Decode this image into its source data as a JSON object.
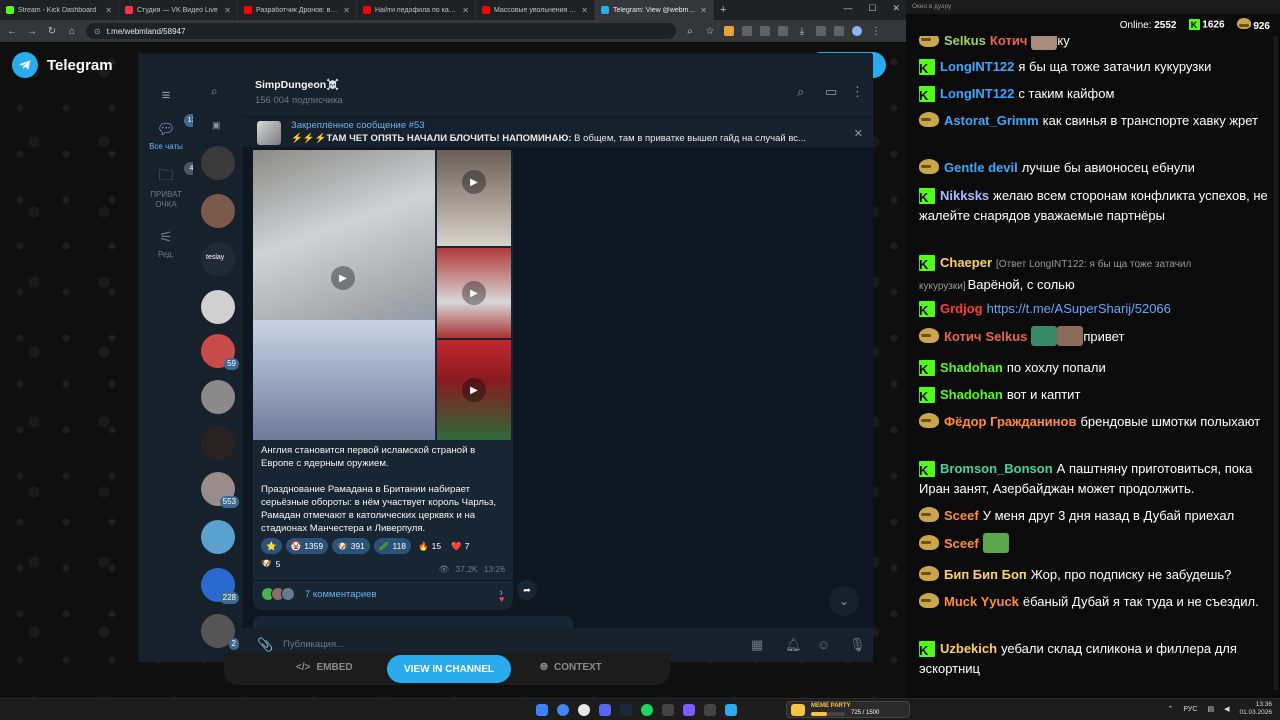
{
  "browser": {
    "tabs": [
      {
        "label": "Stream - Kick Dashboard",
        "color": "#53fc18"
      },
      {
        "label": "Студия — VK Видео Live",
        "color": "#ff3347"
      },
      {
        "label": "Разработчик Дронов: вся...",
        "color": "#ff0000"
      },
      {
        "label": "Найти педофила по картину...",
        "color": "#ff0000"
      },
      {
        "label": "Массовые увольнения 2026...",
        "color": "#ff0000"
      },
      {
        "label": "Telegram: View @webmland",
        "color": "#2aabee",
        "active": true
      }
    ],
    "new_tab": "+",
    "window_controls": [
      "—",
      "☐",
      "✕"
    ],
    "url": "t.me/webmland/58947"
  },
  "tg_page": {
    "logo_text": "Telegram",
    "buttons": {
      "embed": "EMBED",
      "view": "VIEW IN CHANNEL",
      "context": "CONTEXT"
    }
  },
  "tg_window": {
    "rail": [
      {
        "label": "Все чаты",
        "badge": "13",
        "icon": "chat-bubbles-icon",
        "active": true
      },
      {
        "label": "ПРИВАТ ОЧКА",
        "badge": "4",
        "icon": "folder-icon"
      },
      {
        "label": "Ред.",
        "icon": "sliders-icon"
      }
    ],
    "chat_list_counts": [
      "59",
      "553",
      "228",
      "2"
    ],
    "chat_list_label": "teslay",
    "channel": {
      "name": "SimpDungeon☠️",
      "subscribers": "156 004 подписчика"
    },
    "pinned": {
      "title": "Закреплённое сообщение #53",
      "text_bold": "⚡⚡⚡ТАМ ЧЕТ ОПЯТЬ НАЧАЛИ БЛОЧИТЬ! НАПОМИНАЮ:",
      "text_rest": " В общем, там в приватке вышел гайд на случай вс..."
    },
    "post": {
      "caption_1": "Англия становится первой исламской страной в Европе с ядерным оружием.",
      "caption_2": "Празднование Рамадана в Британии набирает серьёзные обороты: в нём участвует король Чарльз, Рамадан отмечают в католических церквях и на стадионах Манчестера и Ливерпуля.",
      "reactions": [
        {
          "emoji": "⭐",
          "count": ""
        },
        {
          "emoji": "🤡",
          "count": "1359"
        },
        {
          "emoji": "🐶",
          "count": "391"
        },
        {
          "emoji": "🥒",
          "count": "118"
        },
        {
          "emoji": "🔥",
          "count": "15",
          "plain": true
        },
        {
          "emoji": "❤️",
          "count": "7",
          "plain": true
        }
      ],
      "reaction_extra": {
        "emoji": "🐶",
        "count": "5"
      },
      "views": "37.2K",
      "time": "13:26",
      "comments": "7 комментариев"
    },
    "composer_placeholder": "Публикация..."
  },
  "chat": {
    "window_title": "Окно в дуэру",
    "online_label": "Online:",
    "online": "2552",
    "kick_count": "1626",
    "vk_count": "926",
    "messages": [
      {
        "badge": "pepe",
        "user": "Selkus",
        "color": "#9bd35a",
        "extra_user": "Котич",
        "extra_color": "#e5644a",
        "text": "ку",
        "emote": "#a98b7a",
        "emote_before_text": true
      },
      {
        "badge": "kick",
        "user": "LongINT122",
        "color": "#3aa7ff",
        "text": "я бы ща тоже затачил кукурузки"
      },
      {
        "badge": "kick",
        "user": "LongINT122",
        "color": "#3aa7ff",
        "text": "с таким кайфом"
      },
      {
        "badge": "pepe",
        "user": "Astorat_Grimm",
        "color": "#3aa7ff",
        "text": "как свинья в транспорте хавку жрет"
      },
      {
        "badge": "pepe",
        "user": "Gentle devil",
        "color": "#3aa7ff",
        "text": "лучше бы авионосец ебнули"
      },
      {
        "badge": "kick",
        "user": "Nikksks",
        "color": "#aab8ff",
        "text": "желаю всем сторонам конфликта успехов, не жалейте снарядов уважаемые партнёры"
      },
      {
        "badge": "kick",
        "user": "Chaeper",
        "color": "#ffcf5c",
        "reply": "[Ответ LongINT122: я бы ща тоже затачил кукурузки]",
        "text": "Варёной, с солью"
      },
      {
        "badge": "kick",
        "user": "Grdjog",
        "color": "#ff3b30",
        "text": "https://t.me/ASuperSharij/52066",
        "is_link": true
      },
      {
        "badge": "pepe",
        "user": "Котич",
        "color": "#e5644a",
        "extra_user": "Selkus",
        "extra_color": "#e5644a",
        "text": "привет",
        "emote": "#3a8a6a",
        "emote2": "#8c6a5a"
      },
      {
        "badge": "kick",
        "user": "Shadohan",
        "color": "#53fc18",
        "text": "по хохлу попали"
      },
      {
        "badge": "kick",
        "user": "Shadohan",
        "color": "#53fc18",
        "text": "вот и каптит"
      },
      {
        "badge": "pepe",
        "user": "Фёдор Гражданинов",
        "color": "#ff8a3a",
        "text": "брендовые шмотки полыхают"
      },
      {
        "badge": "kick",
        "user": "Bromson_Bonson",
        "color": "#3ad6a4",
        "text": "А паштняну приготовиться, пока Иран занят, Азербайджан может продолжить."
      },
      {
        "badge": "pepe",
        "user": "Sceef",
        "color": "#ff8a3a",
        "text": "У меня друг 3 дня назад в Дубай приехал"
      },
      {
        "badge": "pepe",
        "user": "Sceef",
        "color": "#ff8a3a",
        "text": "",
        "emote": "#5aa84a"
      },
      {
        "badge": "pepe",
        "user": "Бип Бип Боп",
        "color": "#ffcf5c",
        "text": "Жор, про подписку не забудешь?"
      },
      {
        "badge": "pepe",
        "user": "Muck Yyuck",
        "color": "#ff8a3a",
        "text": "ёбаный Дубай я так туда и не съездил."
      },
      {
        "badge": "kick",
        "user": "Uzbekich",
        "color": "#ffcf5c",
        "text": "уебали склад силикона и филлера для эскортниц"
      }
    ]
  },
  "taskbar": {
    "promo_title": "MEME PARTY",
    "promo_count": "725 / 1500",
    "promo_progress": 0.48,
    "lang": "РУС",
    "time": "13:36",
    "date": "01.03.2026"
  }
}
